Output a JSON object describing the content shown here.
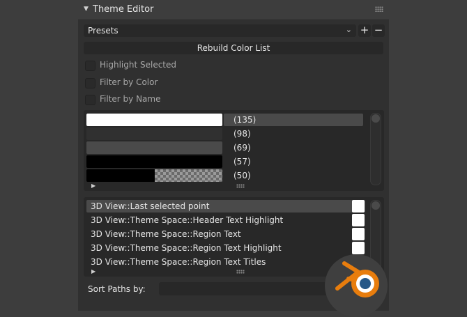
{
  "header": {
    "title": "Theme Editor"
  },
  "presets": {
    "label": "Presets",
    "add_label": "+",
    "remove_label": "−"
  },
  "rebuild_label": "Rebuild Color List",
  "filters": [
    {
      "label": "Highlight Selected",
      "checked": false
    },
    {
      "label": "Filter by Color",
      "checked": false
    },
    {
      "label": "Filter by Name",
      "checked": false
    }
  ],
  "color_list": {
    "items": [
      {
        "count": "(135)",
        "swatch": "#ffffff",
        "active": true
      },
      {
        "count": "(98)",
        "swatch": "#303030",
        "active": false
      },
      {
        "count": "(69)",
        "swatch": "#4a4a4a",
        "active": false
      },
      {
        "count": "(57)",
        "swatch": "#000000",
        "active": false
      },
      {
        "count": "(50)",
        "swatch": "#000000 + transparent",
        "active": false
      }
    ]
  },
  "path_list": {
    "items": [
      {
        "path": "3D View::Last selected point",
        "active": true
      },
      {
        "path": "3D View::Theme Space::Header Text Highlight",
        "active": false
      },
      {
        "path": "3D View::Theme Space::Region Text",
        "active": false
      },
      {
        "path": "3D View::Theme Space::Region Text Highlight",
        "active": false
      },
      {
        "path": "3D View::Theme Space::Region Text Titles",
        "active": false
      }
    ]
  },
  "sort": {
    "label": "Sort Paths by:",
    "value": ""
  },
  "colors": {
    "accent": "#e87d0d",
    "logo_blue": "#265787"
  }
}
